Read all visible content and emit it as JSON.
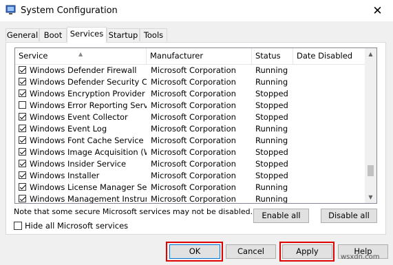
{
  "window": {
    "title": "System Configuration",
    "close_glyph": "✕"
  },
  "tabs": [
    "General",
    "Boot",
    "Services",
    "Startup",
    "Tools"
  ],
  "active_tab": "Services",
  "columns": [
    "Service",
    "Manufacturer",
    "Status",
    "Date Disabled"
  ],
  "services": [
    {
      "name": "Windows Defender Firewall",
      "manufacturer": "Microsoft Corporation",
      "status": "Running",
      "checked": true
    },
    {
      "name": "Windows Defender Security Cen...",
      "manufacturer": "Microsoft Corporation",
      "status": "Running",
      "checked": true
    },
    {
      "name": "Windows Encryption Provider Ho...",
      "manufacturer": "Microsoft Corporation",
      "status": "Stopped",
      "checked": true
    },
    {
      "name": "Windows Error Reporting Service",
      "manufacturer": "Microsoft Corporation",
      "status": "Stopped",
      "checked": false
    },
    {
      "name": "Windows Event Collector",
      "manufacturer": "Microsoft Corporation",
      "status": "Stopped",
      "checked": true
    },
    {
      "name": "Windows Event Log",
      "manufacturer": "Microsoft Corporation",
      "status": "Running",
      "checked": true
    },
    {
      "name": "Windows Font Cache Service",
      "manufacturer": "Microsoft Corporation",
      "status": "Running",
      "checked": true
    },
    {
      "name": "Windows Image Acquisition (WIA)",
      "manufacturer": "Microsoft Corporation",
      "status": "Stopped",
      "checked": true
    },
    {
      "name": "Windows Insider Service",
      "manufacturer": "Microsoft Corporation",
      "status": "Stopped",
      "checked": true
    },
    {
      "name": "Windows Installer",
      "manufacturer": "Microsoft Corporation",
      "status": "Stopped",
      "checked": true
    },
    {
      "name": "Windows License Manager Service",
      "manufacturer": "Microsoft Corporation",
      "status": "Running",
      "checked": true
    },
    {
      "name": "Windows Management Instrume...",
      "manufacturer": "Microsoft Corporation",
      "status": "Running",
      "checked": true
    }
  ],
  "note": "Note that some secure Microsoft services may not be disabled.",
  "buttons": {
    "enable_all": "Enable all",
    "disable_all": "Disable all",
    "ok": "OK",
    "cancel": "Cancel",
    "apply": "Apply",
    "help": "Help"
  },
  "hide_ms": {
    "label": "Hide all Microsoft services",
    "checked": false
  },
  "watermark": "wsxdn.com",
  "colors": {
    "highlight_box": "#e00000",
    "focus_border": "#0078d7"
  }
}
